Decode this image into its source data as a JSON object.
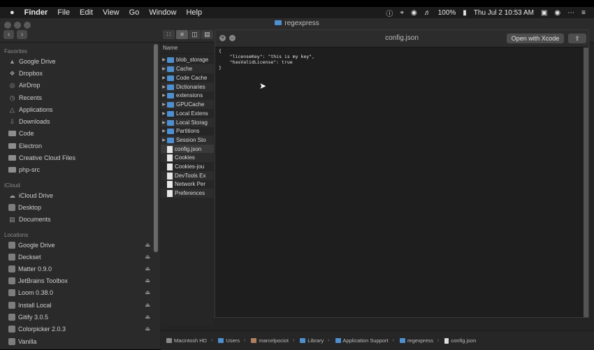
{
  "menubar": {
    "apple_icon": "apple-icon",
    "items": [
      "Finder",
      "File",
      "Edit",
      "View",
      "Go",
      "Window",
      "Help"
    ],
    "battery": "100%",
    "clock": "Thu Jul 2  10:53 AM"
  },
  "window": {
    "title": "regexpress"
  },
  "sidebar": {
    "favorites_title": "Favorites",
    "favorites": [
      "Google Drive",
      "Dropbox",
      "AirDrop",
      "Recents",
      "Applications",
      "Downloads",
      "Code",
      "Electron",
      "Creative Cloud Files",
      "php-src"
    ],
    "icloud_title": "iCloud",
    "icloud": [
      "iCloud Drive",
      "Desktop",
      "Documents"
    ],
    "locations_title": "Locations",
    "locations": [
      "Google Drive",
      "Deckset",
      "Matter 0.9.0",
      "JetBrains Toolbox",
      "Loom 0.38.0",
      "Install Local",
      "Gitify 3.0.5",
      "Colorpicker 2.0.3",
      "Vanilla"
    ]
  },
  "filelist": {
    "header": "Name",
    "folders": [
      "blob_storage",
      "Cache",
      "Code Cache",
      "Dictionaries",
      "extensions",
      "GPUCache",
      "Local Extens",
      "Local Storag",
      "Partitions",
      "Session Sto"
    ],
    "files": [
      "config.json",
      "Cookies",
      "Cookies-jou",
      "DevTools Ex",
      "Network Per",
      "Preferences"
    ]
  },
  "preview": {
    "title": "config.json",
    "open_button": "Open with Xcode",
    "code": "{\n    \"licenseKey\": \"this is my key\",\n    \"hasValidLicense\": true\n}"
  },
  "pathbar": [
    "Macintosh HD",
    "Users",
    "marcelpociot",
    "Library",
    "Application Support",
    "regexpress",
    "config.json"
  ]
}
